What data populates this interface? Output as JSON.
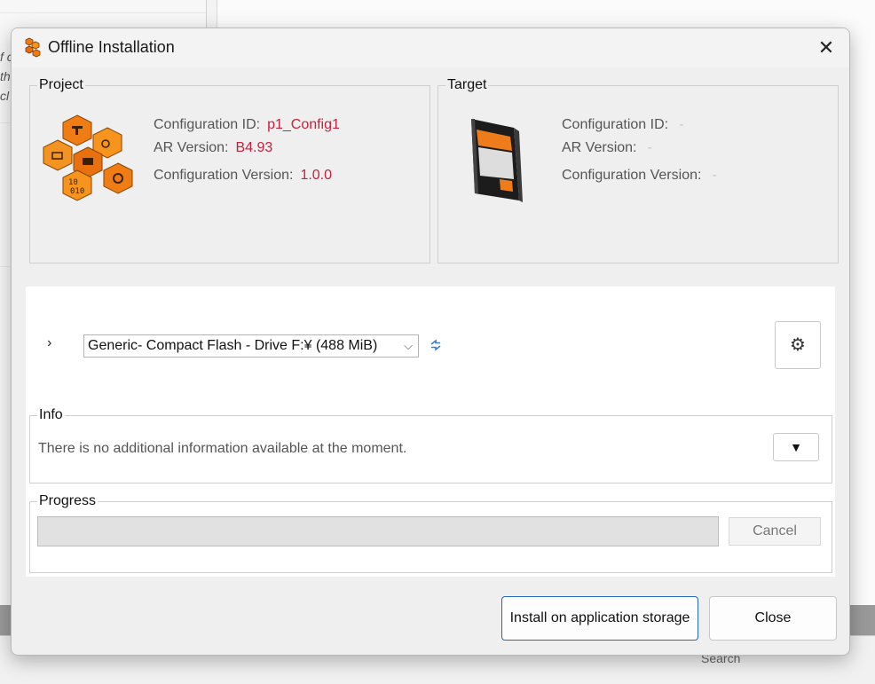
{
  "background": {
    "italic_lines": [
      "f c",
      "th",
      "cl"
    ],
    "search_label": "Search"
  },
  "dialog": {
    "title": "Offline Installation",
    "close_glyph": "✕"
  },
  "project": {
    "legend": "Project",
    "icon": "project-honeycomb-icon",
    "config_id_label": "Configuration ID:",
    "config_id_value": "p1_Config1",
    "ar_version_label": "AR Version:",
    "ar_version_value": "B4.93",
    "config_version_label": "Configuration Version:",
    "config_version_value": "1.0.0"
  },
  "target": {
    "legend": "Target",
    "icon": "compact-flash-card-icon",
    "config_id_label": "Configuration ID:",
    "config_id_value": "-",
    "ar_version_label": "AR Version:",
    "ar_version_value": "-",
    "config_version_label": "Configuration Version:",
    "config_version_value": "-"
  },
  "drive": {
    "expand_glyph": "›",
    "selected": "Generic- Compact Flash - Drive F:¥ (488 MiB)",
    "dropdown_glyph": "⌵",
    "settings_glyph": "⚙"
  },
  "info": {
    "legend": "Info",
    "text": "There is no additional information available at the moment.",
    "toggle_glyph": "▼"
  },
  "progress": {
    "legend": "Progress",
    "value": 0,
    "cancel_label": "Cancel"
  },
  "buttons": {
    "install_label": "Install on application storage",
    "close_label": "Close"
  },
  "colors": {
    "value_red": "#c8203c",
    "accent_blue": "#2468c0",
    "brand_orange": "#f07d14"
  }
}
